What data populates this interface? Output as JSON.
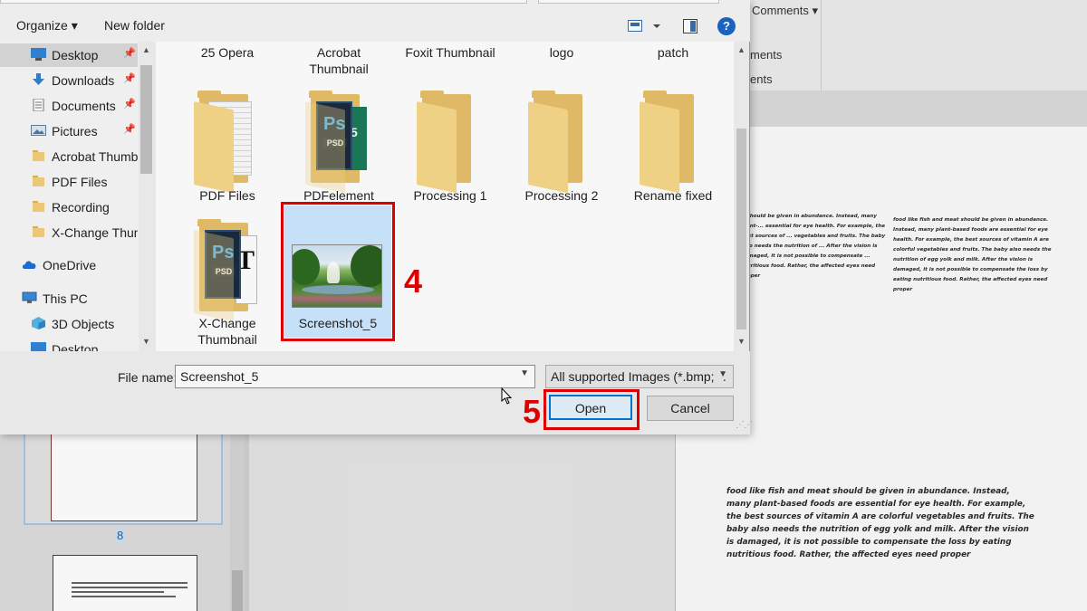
{
  "background_app": {
    "ribbon": {
      "comments_label": "Comments",
      "partial_item_1": "ments",
      "partial_item_2": "ents"
    },
    "page_thumbnail_number": "8",
    "doc_paragraph_small_1": "...should be given in abundance. Instead, many plant-... essential for eye health. For example, the best sources of ... vegetables and fruits. The baby also needs the nutrition of ... After the vision is damaged, it is not possible to compensate ... nutritious food. Rather, the affected eyes need proper",
    "doc_paragraph_small_2": "food like fish and meat should be given in abundance. Instead, many plant-based foods are essential for eye health. For example, the best sources of vitamin A are colorful vegetables and fruits. The baby also needs the nutrition of egg yolk and milk. After the vision is damaged, it is not possible to compensate the loss by eating nutritious food. Rather, the affected eyes need proper",
    "doc_paragraph_large": "food like fish and meat should be given in abundance. Instead, many plant-based foods are essential for eye health. For example, the best sources of vitamin A are colorful vegetables and fruits. The baby also needs the nutrition of egg yolk and milk. After the vision is damaged, it is not possible to compensate the loss by eating nutritious food. Rather, the affected eyes need proper"
  },
  "dialog": {
    "toolbar": {
      "organize_label": "Organize ▾",
      "new_folder_label": "New folder",
      "help_label": "?"
    },
    "nav": {
      "items": [
        {
          "label": "Desktop",
          "icon": "desktop-icon",
          "pinned": "📌"
        },
        {
          "label": "Downloads",
          "icon": "download-icon",
          "pinned": "📌"
        },
        {
          "label": "Documents",
          "icon": "documents-icon",
          "pinned": "📌"
        },
        {
          "label": "Pictures",
          "icon": "pictures-icon",
          "pinned": "📌"
        },
        {
          "label": "Acrobat Thumbn",
          "icon": "folder-icon"
        },
        {
          "label": "PDF Files",
          "icon": "folder-icon"
        },
        {
          "label": "Recording",
          "icon": "folder-icon"
        },
        {
          "label": "X-Change Thuml",
          "icon": "folder-icon"
        },
        {
          "label": "OneDrive",
          "icon": "onedrive-icon"
        },
        {
          "label": "This PC",
          "icon": "this-pc-icon"
        },
        {
          "label": "3D Objects",
          "icon": "3d-objects-icon"
        },
        {
          "label": "Desktop",
          "icon": "desktop-icon"
        }
      ]
    },
    "files": {
      "row0": [
        "25 Opera",
        "Acrobat\nThumbnail",
        "Foxit Thumbnail",
        "logo",
        "patch"
      ],
      "row1": [
        "PDF Files",
        "PDFelement",
        "Processing 1",
        "Processing 2",
        "Rename fixed"
      ],
      "row2": [
        "X-Change\nThumbnail",
        "Screenshot_5"
      ]
    },
    "file_name_label": "File name:",
    "file_name_value": "Screenshot_5",
    "filter_value": "All supported Images (*.bmp; *.",
    "open_label": "Open",
    "cancel_label": "Cancel"
  },
  "annotations": {
    "step_select": "4",
    "step_open": "5"
  }
}
